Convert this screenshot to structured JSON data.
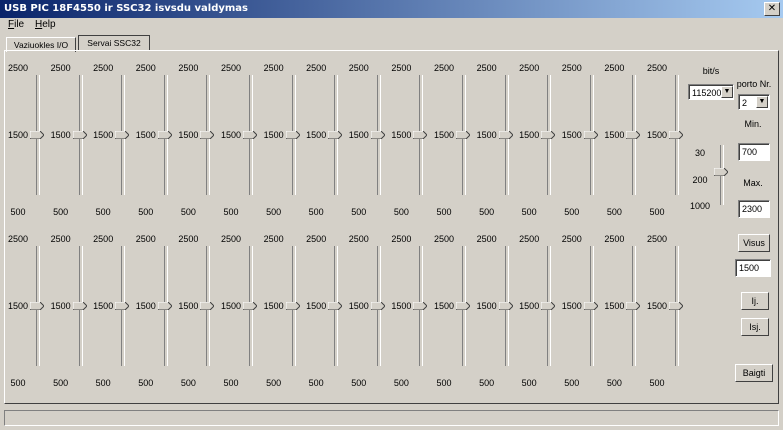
{
  "window": {
    "title": "USB PIC 18F4550 ir SSC32 isvsdu valdymas",
    "close": "✕"
  },
  "menu": {
    "file": "File",
    "help": "Help"
  },
  "tabs": [
    {
      "label": "Vaziuokles I/O"
    },
    {
      "label": "Servai SSC32"
    }
  ],
  "sliders": {
    "max_label": "2500",
    "mid_label": "1500",
    "min_label": "500",
    "rows": [
      {
        "count": 16,
        "value": 1500,
        "min": 500,
        "max": 2500
      },
      {
        "count": 16,
        "value": 1500,
        "min": 500,
        "max": 2500
      }
    ]
  },
  "speed_slider": {
    "label_top": "30",
    "label_mid": "200",
    "label_bottom": "1000",
    "value": 200
  },
  "right_panel": {
    "baud_label": "bit/s",
    "baud_value": "115200",
    "port_label": "porto Nr.",
    "port_value": "2",
    "min_label": "Min.",
    "min_value": "700",
    "max_label": "Max.",
    "max_value": "2300",
    "all_button": "Visus",
    "all_value": "1500",
    "on_button": "Ij.",
    "off_button": "Isj.",
    "exit_button": "Baigti"
  }
}
